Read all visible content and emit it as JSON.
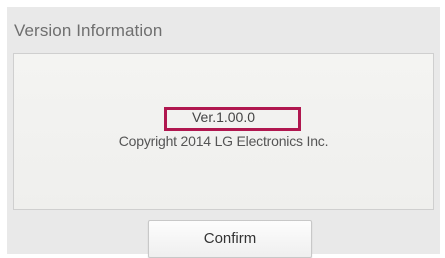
{
  "dialog": {
    "title": "Version Information",
    "version": "Ver.1.00.0",
    "copyright": "Copyright  2014 LG Electronics Inc.",
    "confirm_label": "Confirm",
    "highlight_color": "#b0174f"
  }
}
